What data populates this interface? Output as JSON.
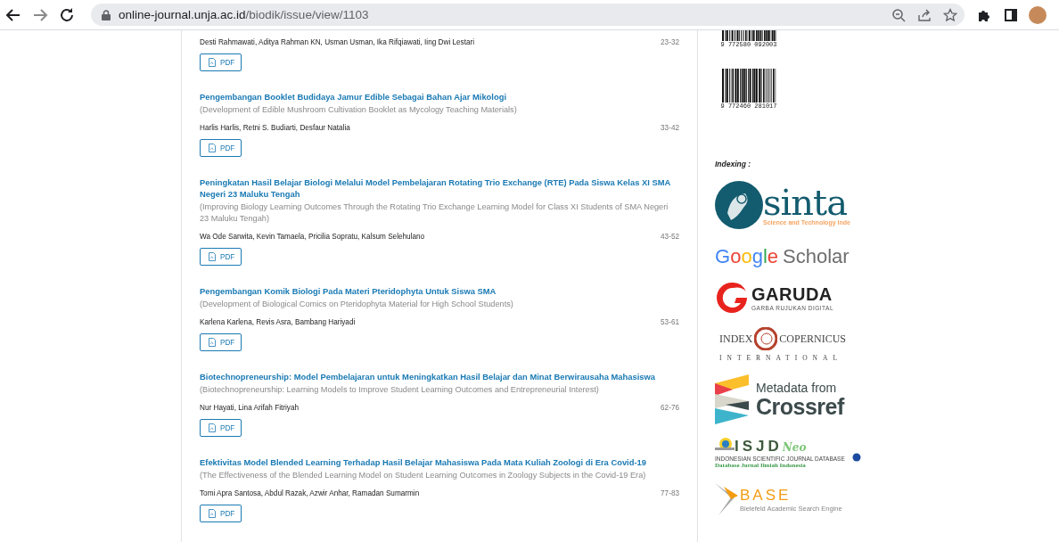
{
  "browser": {
    "url": {
      "host": "online-journal.unja.ac.id",
      "path": "/biodik/issue/view/1103"
    }
  },
  "articles": [
    {
      "authors": "Desti Rahmawati, Aditya Rahman KN, Usman Usman, Ika Rifqiawati, Iing Dwi Lestari",
      "pages": "23-32",
      "button": "PDF"
    },
    {
      "title": "Pengembangan Booklet Budidaya Jamur Edible Sebagai Bahan Ajar Mikologi",
      "subtitle": "(Development of Edible Mushroom Cultivation Booklet as Mycology Teaching Materials)",
      "authors": "Harlis Harlis, Retni S. Budiarti, Desfaur Natalia",
      "pages": "33-42",
      "button": "PDF"
    },
    {
      "title": "Peningkatan Hasil Belajar Biologi Melalui Model Pembelajaran Rotating Trio Exchange (RTE) Pada Siswa Kelas XI SMA Negeri 23 Maluku Tengah",
      "subtitle": "(Improving Biology Learning Outcomes Through the Rotating Trio Exchange Learning Model for Class XI Students of SMA Negeri 23 Maluku Tengah)",
      "authors": "Wa Ode Sarwita, Kevin Tamaela, Pricilia Sopratu, Kalsum Selehulano",
      "pages": "43-52",
      "button": "PDF"
    },
    {
      "title": "Pengembangan Komik Biologi Pada Materi Pteridophyta Untuk Siswa SMA",
      "subtitle": "(Development of Biological Comics on Pteridophyta Material for High School Students)",
      "authors": "Karlena Karlena, Revis Asra, Bambang Hariyadi",
      "pages": "53-61",
      "button": "PDF"
    },
    {
      "title": "Biotechnopreneurship: Model Pembelajaran untuk Meningkatkan Hasil Belajar dan Minat Berwirausaha Mahasiswa",
      "subtitle": "(Biotechnopreneurship: Learning Models to Improve Student Learning Outcomes and Entrepreneurial Interest)",
      "authors": "Nur Hayati, Lina Arifah Fitriyah",
      "pages": "62-76",
      "button": "PDF"
    },
    {
      "title": "Efektivitas Model Blended Learning Terhadap Hasil Belajar Mahasiswa Pada Mata Kuliah Zoologi di Era Covid-19",
      "subtitle": "(The Effectiveness of the Blended Learning Model on Student Learning Outcomes in Zoology Subjects in the Covid-19 Era)",
      "authors": "Tomi Apra Santosa, Abdul Razak, Azwir Anhar, Ramadan Sumarmin",
      "pages": "77-83",
      "button": "PDF"
    }
  ],
  "sidebar": {
    "barcodes": [
      {
        "number": "9 772580 092003",
        "cut": true
      },
      {
        "number": "9 772460 281017",
        "cut": false
      }
    ],
    "indexing_label": "Indexing :",
    "logos": [
      {
        "kind": "sinta",
        "name": "sinta",
        "tagline": "Science and Technology Inde"
      },
      {
        "kind": "google",
        "name": "Google",
        "tagline": "Scholar"
      },
      {
        "kind": "garuda",
        "name": "GARUDA",
        "tagline": "GARBA RUJUKAN DIGITAL"
      },
      {
        "kind": "copernicus",
        "name": "INDEX",
        "second": "COPERNICUS",
        "tagline": "INTERNATIONAL"
      },
      {
        "kind": "crossref",
        "name": "Crossref",
        "tagline": "Metadata from"
      },
      {
        "kind": "isjd",
        "name": "ISJD",
        "second": "Neo",
        "tagline": "INDONESIAN SCIENTIFIC JOURNAL DATABASE",
        "tagline2": "Database Jurnal Ilmiah Indonesia"
      },
      {
        "kind": "base",
        "name": "BASE",
        "tagline": "Bielefeld Academic Search Engine"
      }
    ]
  }
}
